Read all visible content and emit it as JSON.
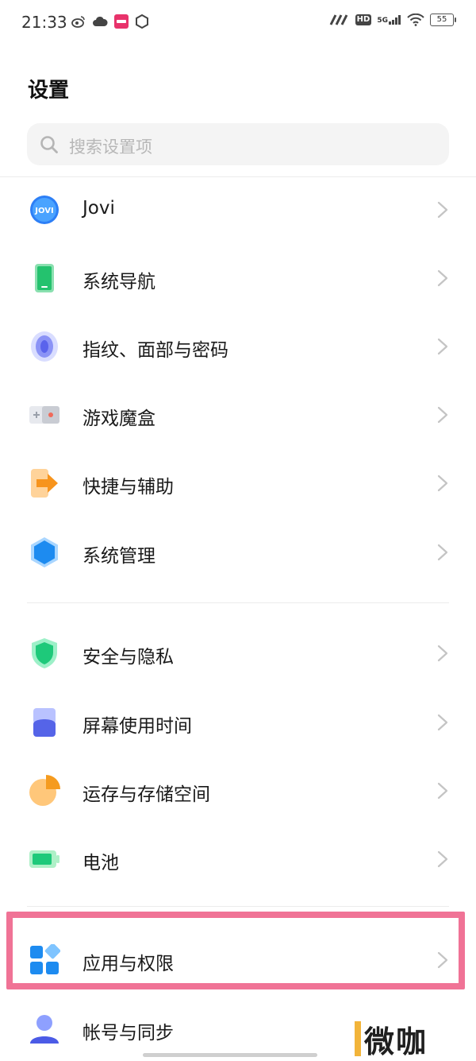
{
  "status_bar": {
    "time": "21:33",
    "left_icons": [
      "weibo-icon",
      "cloud-icon",
      "app-badge-icon",
      "hexagon-icon"
    ],
    "right_icons": [
      "signal-icon",
      "hd-icon",
      "5g-signal-icon",
      "wifi-icon",
      "battery-icon"
    ],
    "hd_label": "HD",
    "network": "5G",
    "battery": "55"
  },
  "page": {
    "title": "设置"
  },
  "search": {
    "placeholder": "搜索设置项"
  },
  "settings": {
    "group1": [
      {
        "label": "Jovi",
        "icon": "jovi-icon"
      },
      {
        "label": "系统导航",
        "icon": "phone-navigation-icon"
      },
      {
        "label": "指纹、面部与密码",
        "icon": "fingerprint-icon"
      },
      {
        "label": "游戏魔盒",
        "icon": "game-box-icon"
      },
      {
        "label": "快捷与辅助",
        "icon": "shortcut-arrow-icon"
      },
      {
        "label": "系统管理",
        "icon": "system-hexagon-icon"
      }
    ],
    "group2": [
      {
        "label": "安全与隐私",
        "icon": "shield-icon"
      },
      {
        "label": "屏幕使用时间",
        "icon": "screen-time-icon"
      },
      {
        "label": "运存与存储空间",
        "icon": "storage-pie-icon"
      },
      {
        "label": "电池",
        "icon": "battery-icon"
      }
    ],
    "group3": [
      {
        "label": "应用与权限",
        "icon": "apps-grid-icon",
        "highlighted": true
      },
      {
        "label": "帐号与同步",
        "icon": "account-icon"
      }
    ]
  },
  "colors": {
    "highlight": "#f07396",
    "accent": "#2aa7f0"
  },
  "watermark": {
    "text": "微咖"
  }
}
